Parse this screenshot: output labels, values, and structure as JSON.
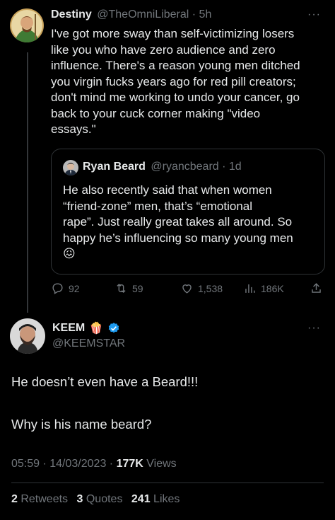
{
  "parent_tweet": {
    "author_name": "Destiny",
    "handle_time": "@TheOmniLiberal · 5h",
    "text_lines": [
      "I've got more sway than self-victimizing losers",
      "like you who have zero audience and zero",
      "influence. There's a reason young men ditched",
      "you virgin fucks years ago for red pill creators;",
      "don't mind me working to undo your cancer, go",
      "back to your cuck corner making \"video",
      "essays.\""
    ],
    "more_label": "···",
    "quote": {
      "author_name": "Ryan Beard",
      "handle_time": "@ryancbeard · 1d",
      "text_lines": [
        "He also recently said that when women",
        "“friend-zone” men, that’s “emotional",
        "rape”. Just really great takes all around. So",
        "happy he’s influencing so many young men"
      ],
      "emoji": "😖"
    },
    "actions": {
      "replies": "92",
      "retweets": "59",
      "likes": "1,538",
      "views": "186K"
    }
  },
  "main_tweet": {
    "author_name": "KEEM",
    "emoji": "🍿",
    "handle": "@KEEMSTAR",
    "more_label": "···",
    "text_line1": "He doesn’t even have a Beard!!!",
    "text_line2": "Why is his name beard?",
    "meta_time": "05:59 · 14/03/2023 · ",
    "views_count": "177K",
    "views_label": " Views",
    "retweets_count": "2",
    "retweets_label": " Retweets",
    "quotes_count": "3",
    "quotes_label": " Quotes",
    "likes_count": "241",
    "likes_label": " Likes"
  },
  "colors": {
    "background": "#000000",
    "text": "#e7e9ea",
    "muted": "#71767b",
    "verified": "#1d9bf0",
    "border": "#2f3336"
  }
}
